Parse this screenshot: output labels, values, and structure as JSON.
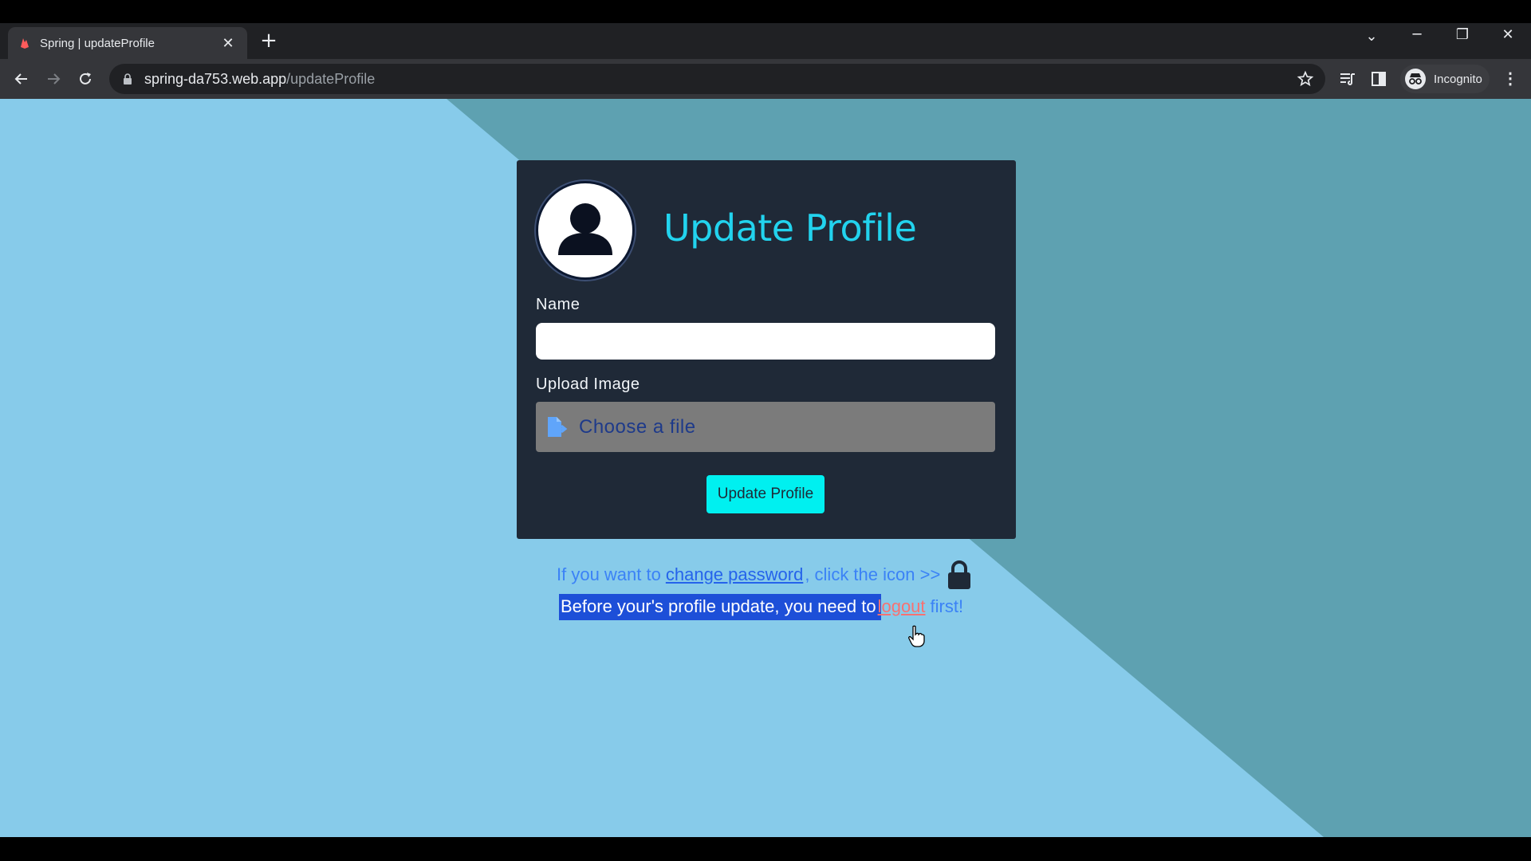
{
  "browser": {
    "tab_title": "Spring | updateProfile",
    "tab_close": "✕",
    "new_tab": "+",
    "url_host": "spring-da753.web.app",
    "url_path": "/updateProfile",
    "profile_label": "Incognito",
    "menu": "⋮"
  },
  "window_controls": {
    "dropdown": "⌄",
    "minimize": "─",
    "restore": "❐",
    "close": "✕"
  },
  "form": {
    "title": "Update Profile",
    "name_label": "Name",
    "name_value": "",
    "upload_label": "Upload Image",
    "file_placeholder": "Choose a file",
    "submit_label": "Update Profile"
  },
  "notes": {
    "password_prefix": "If you want to",
    "password_link": "change password",
    "password_suffix": ", click the icon >>",
    "logout_prefix": "Before your's profile update, you need to",
    "logout_link_first_letter": "l",
    "logout_link_rest": "ogout",
    "logout_suffix": "first!"
  },
  "colors": {
    "page_bg_light": "#87cbea",
    "page_bg_dark": "#5ea1b1",
    "card_bg": "#1f2937",
    "title_cyan": "#22d3ee",
    "button_cyan": "#00f0f0",
    "link_blue": "#2563eb",
    "logout_red": "#f87171",
    "selection_blue": "#1d4fd8"
  }
}
